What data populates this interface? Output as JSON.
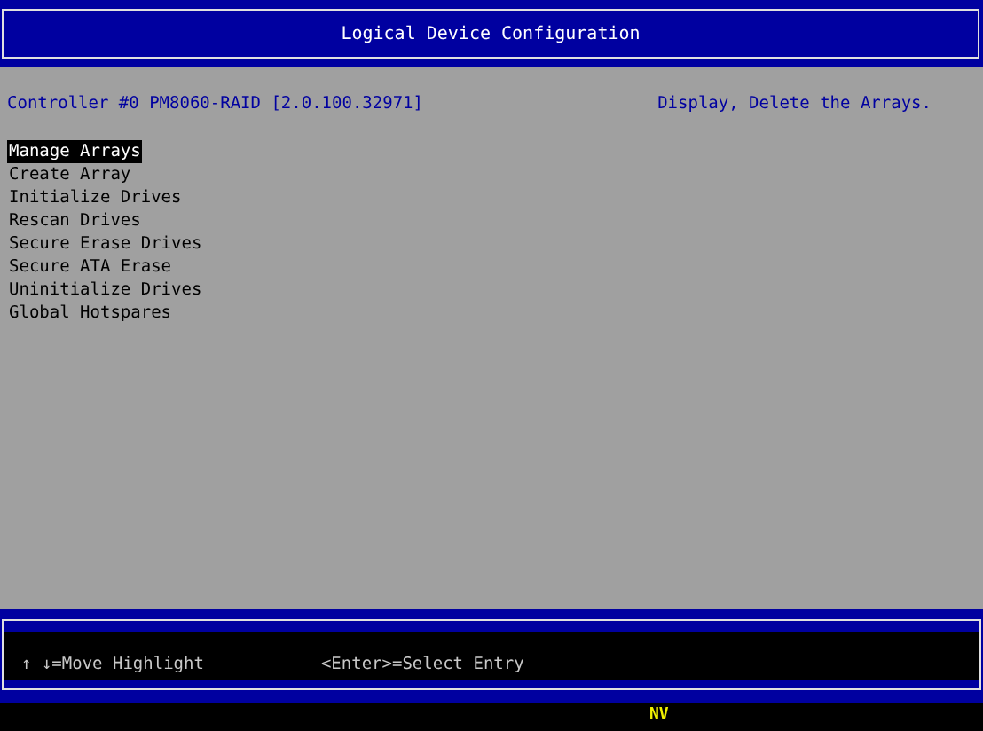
{
  "window": {
    "title": "Logical Device Configuration"
  },
  "header": {
    "controller": "Controller #0 PM8060-RAID [2.0.100.32971]",
    "help": "Display, Delete the Arrays."
  },
  "menu": [
    {
      "label": "Manage Arrays",
      "selected": true
    },
    {
      "label": "Create Array",
      "selected": false
    },
    {
      "label": "Initialize Drives",
      "selected": false
    },
    {
      "label": "Rescan Drives",
      "selected": false
    },
    {
      "label": "Secure Erase Drives",
      "selected": false
    },
    {
      "label": "Secure ATA Erase",
      "selected": false
    },
    {
      "label": "Uninitialize Drives",
      "selected": false
    },
    {
      "label": "Global Hotspares",
      "selected": false
    }
  ],
  "footer": {
    "keys": [
      {
        "key": "↑ ↓",
        "action": "=Move Highlight"
      },
      {
        "key": "<Enter>",
        "action": "=Select Entry"
      }
    ]
  },
  "status_bar": {
    "indicator": "NV"
  }
}
